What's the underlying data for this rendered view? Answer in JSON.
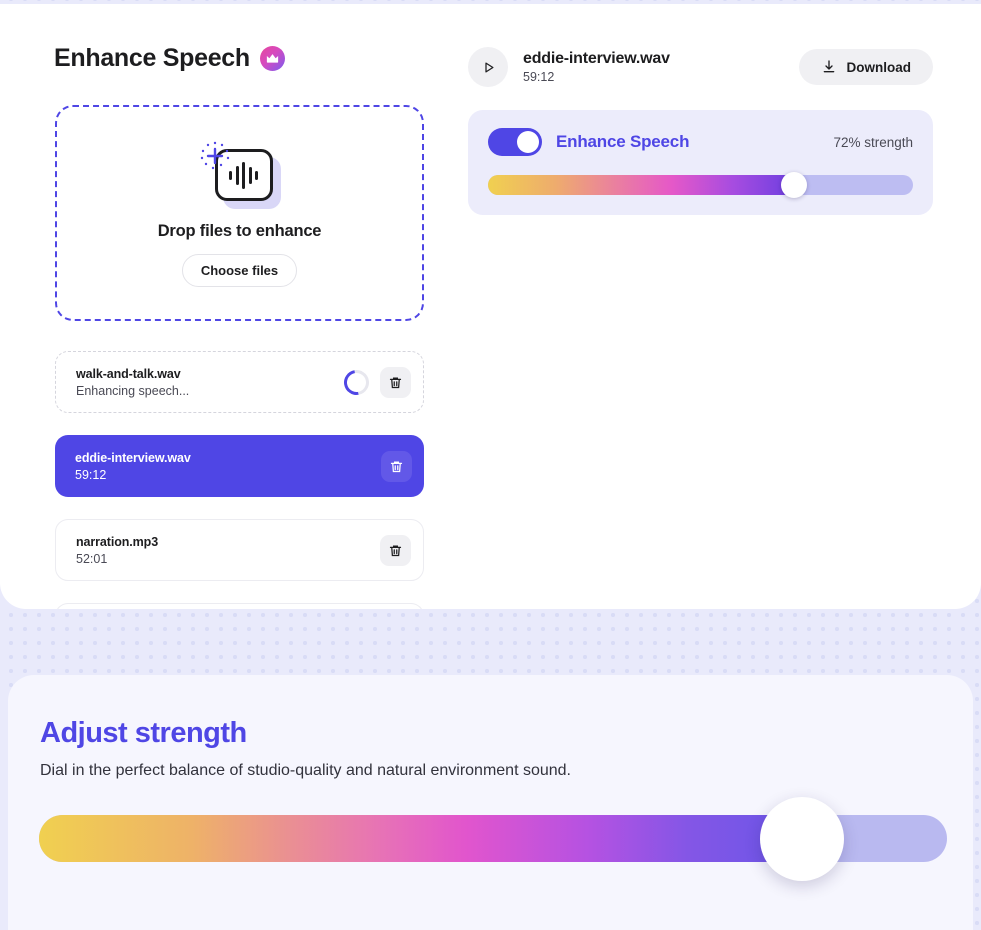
{
  "app": {
    "title": "Enhance Speech",
    "badge_icon": "crown-icon"
  },
  "dropzone": {
    "icon": "audio-file-add-icon",
    "title": "Drop files to enhance",
    "button_label": "Choose files"
  },
  "files": [
    {
      "name": "walk-and-talk.wav",
      "status": "Enhancing speech...",
      "state": "processing",
      "delete_icon": "trash-icon",
      "spinner_icon": "loading-spinner-icon"
    },
    {
      "name": "eddie-interview.wav",
      "status": "59:12",
      "state": "selected",
      "delete_icon": "trash-icon"
    },
    {
      "name": "narration.mp3",
      "status": "52:01",
      "state": "idle",
      "delete_icon": "trash-icon"
    }
  ],
  "player": {
    "play_icon": "play-icon",
    "file_name": "eddie-interview.wav",
    "duration": "59:12",
    "download_label": "Download",
    "download_icon": "download-icon"
  },
  "enhance_card": {
    "toggle_state": "on",
    "label": "Enhance Speech",
    "strength_label": "72% strength",
    "strength_percent": 72
  },
  "adjust_section": {
    "title": "Adjust strength",
    "subtitle": "Dial in the perfect balance of studio-quality and natural environment sound.",
    "slider_percent": 84
  },
  "colors": {
    "accent": "#4f46e5",
    "card_bg": "#ececfb",
    "panel_bg": "#f6f6fe",
    "track_empty": "#b9b9f0"
  }
}
